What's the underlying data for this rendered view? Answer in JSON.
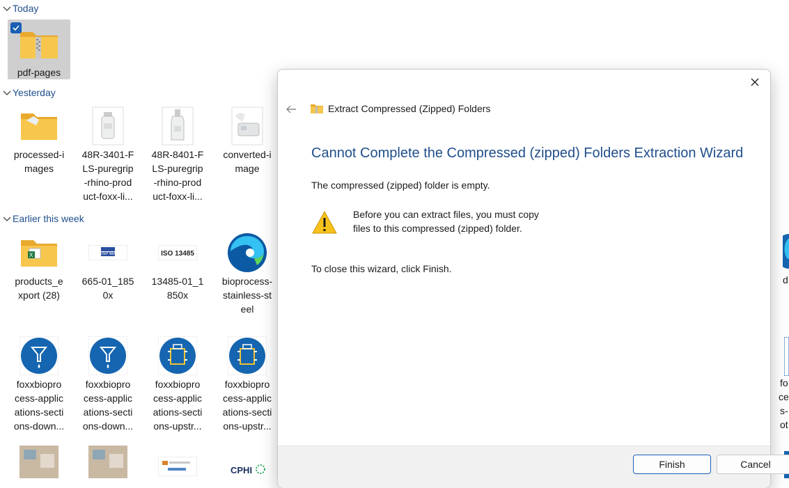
{
  "groups": [
    {
      "label": "Today"
    },
    {
      "label": "Yesterday"
    },
    {
      "label": "Earlier this week"
    }
  ],
  "files": {
    "today": [
      {
        "name": "pdf-pages",
        "icon": "zip-folder-icon",
        "selected": true
      }
    ],
    "yesterday": [
      {
        "name": "processed-i mages",
        "icon": "folder-icon"
      },
      {
        "name": "48R-3401-FLS-puregrip-rhino-product-foxx-li...",
        "icon": "bottle-image-icon"
      },
      {
        "name": "48R-8401-FLS-puregrip-rhino-product-foxx-li...",
        "icon": "bottle-image-icon"
      },
      {
        "name": "converted-i mage",
        "icon": "device-image-icon"
      }
    ],
    "earlier": [
      {
        "name": "products_e xport (28)",
        "icon": "excel-folder-icon"
      },
      {
        "name": "665-01_185 0x",
        "icon": "usp-badge-image-icon"
      },
      {
        "name": "13485-01_1 850x",
        "icon": "iso-badge-image-icon"
      },
      {
        "name": "bioprocess-stainless-st eel",
        "icon": "edge-browser-icon"
      }
    ],
    "row4": [
      {
        "name": "foxxbioprocess-applications-sections-down...",
        "icon": "funnel-circle-icon"
      },
      {
        "name": "foxxbioprocess-applications-sections-down...",
        "icon": "funnel-circle-icon"
      },
      {
        "name": "foxxbioprocess-applications-sections-upstr...",
        "icon": "bioreactor-circle-icon"
      },
      {
        "name": "foxxbioprocess-applications-sections-upstr...",
        "icon": "bioreactor-circle-icon"
      }
    ]
  },
  "label_lines": {
    "pdf": [
      "pdf-pages"
    ],
    "proc": [
      "processed-i",
      "mages"
    ],
    "r1": [
      "48R-3401-F",
      "LS-puregrip",
      "-rhino-prod",
      "uct-foxx-li..."
    ],
    "r2": [
      "48R-8401-F",
      "LS-puregrip",
      "-rhino-prod",
      "uct-foxx-li..."
    ],
    "conv": [
      "converted-i",
      "mage"
    ],
    "prod": [
      "products_e",
      "xport (28)"
    ],
    "usp": [
      "665-01_185",
      "0x"
    ],
    "iso": [
      "13485-01_1",
      "850x"
    ],
    "bio": [
      "bioprocess-",
      "stainless-st",
      "eel"
    ],
    "f1": [
      "foxxbiopro",
      "cess-applic",
      "ations-secti",
      "ons-down..."
    ],
    "f2": [
      "foxxbiopro",
      "cess-applic",
      "ations-secti",
      "ons-down..."
    ],
    "f3": [
      "foxxbiopro",
      "cess-applic",
      "ations-secti",
      "ons-upstr..."
    ],
    "f4": [
      "foxxbiopro",
      "cess-applic",
      "ations-secti",
      "ons-upstr..."
    ]
  },
  "badges": {
    "usp": "USP 665",
    "iso": "ISO 13485",
    "cphi": "CPHI"
  },
  "right_edge": {
    "d": "d",
    "fo": [
      "fo",
      "ce",
      "s-",
      "ot"
    ]
  },
  "dialog": {
    "wizard_title": "Extract Compressed (Zipped) Folders",
    "heading": "Cannot Complete the Compressed (zipped) Folders Extraction Wizard",
    "message": "The compressed (zipped) folder is empty.",
    "warning": "Before you can extract files, you must copy files to this compressed (zipped) folder.",
    "close_hint": "To close this wizard, click Finish.",
    "finish_label": "Finish",
    "cancel_label": "Cancel"
  },
  "colors": {
    "accent": "#1f4e8c",
    "folder": "#f4c14b",
    "blue_circle": "#1565b0"
  }
}
